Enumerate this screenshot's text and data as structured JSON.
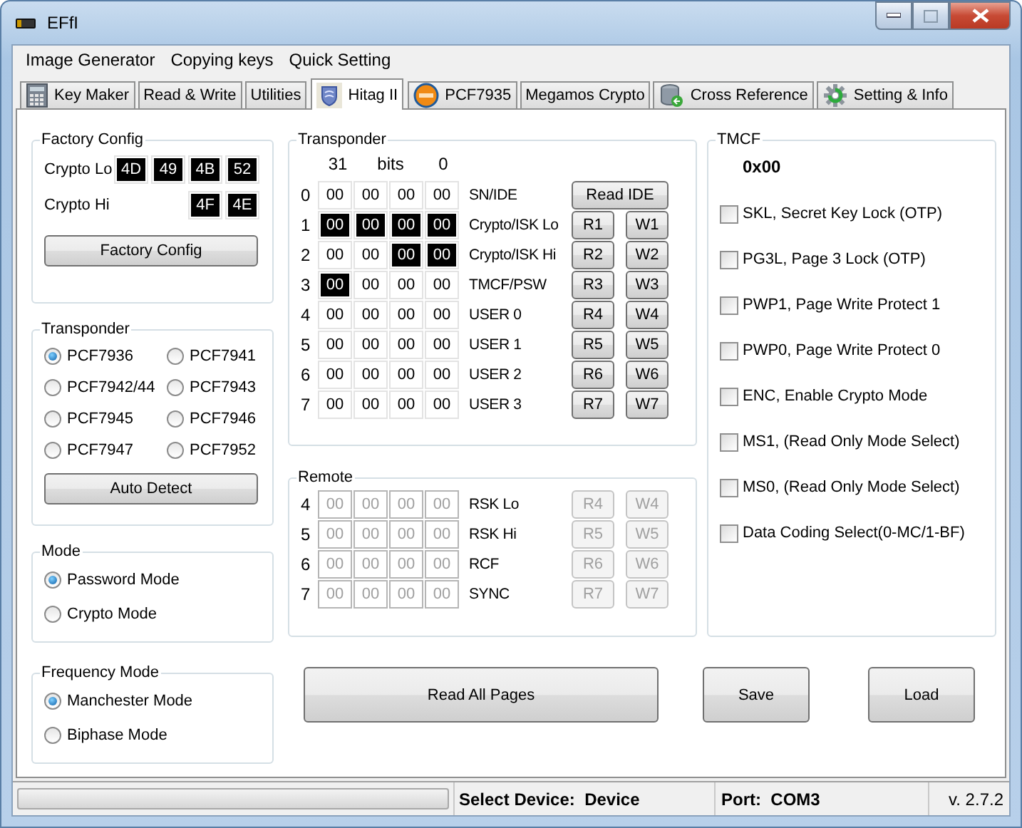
{
  "window": {
    "title": "EFfI"
  },
  "menu": [
    "Image Generator",
    "Copying keys",
    "Quick Setting"
  ],
  "tabs": [
    {
      "label": "Key Maker",
      "selected": false
    },
    {
      "label": "Read & Write",
      "selected": false
    },
    {
      "label": "Utilities",
      "selected": false
    },
    {
      "label": "Hitag II",
      "selected": true
    },
    {
      "label": "PCF7935",
      "selected": false
    },
    {
      "label": "Megamos Crypto",
      "selected": false
    },
    {
      "label": "Cross Reference",
      "selected": false
    },
    {
      "label": "Setting & Info",
      "selected": false
    }
  ],
  "factory_config": {
    "title": "Factory Config",
    "rows": [
      {
        "label": "Crypto Lo",
        "bytes": [
          "4D",
          "49",
          "4B",
          "52"
        ]
      },
      {
        "label": "Crypto Hi",
        "bytes": [
          "4F",
          "4E"
        ]
      }
    ],
    "button": "Factory Config"
  },
  "transponder_type": {
    "title": "Transponder",
    "options": [
      {
        "label": "PCF7936",
        "selected": true
      },
      {
        "label": "PCF7941",
        "selected": false
      },
      {
        "label": "PCF7942/44",
        "selected": false
      },
      {
        "label": "PCF7943",
        "selected": false
      },
      {
        "label": "PCF7945",
        "selected": false
      },
      {
        "label": "PCF7946",
        "selected": false
      },
      {
        "label": "PCF7947",
        "selected": false
      },
      {
        "label": "PCF7952",
        "selected": false
      }
    ],
    "button": "Auto Detect"
  },
  "mode": {
    "title": "Mode",
    "options": [
      {
        "label": "Password Mode",
        "selected": true
      },
      {
        "label": "Crypto Mode",
        "selected": false
      }
    ]
  },
  "frequency_mode": {
    "title": "Frequency Mode",
    "options": [
      {
        "label": "Manchester Mode",
        "selected": true
      },
      {
        "label": "Biphase Mode",
        "selected": false
      }
    ]
  },
  "transponder": {
    "title": "Transponder",
    "disabled": false,
    "header": {
      "msb": "31",
      "unit": "bits",
      "lsb": "0"
    },
    "pages": [
      {
        "index": "0",
        "bytes": [
          {
            "value": "00",
            "highlighted": false
          },
          {
            "value": "00",
            "highlighted": false
          },
          {
            "value": "00",
            "highlighted": false
          },
          {
            "value": "00",
            "highlighted": false
          }
        ],
        "name": "SN/IDE",
        "buttons": [
          "Read IDE"
        ]
      },
      {
        "index": "1",
        "bytes": [
          {
            "value": "00",
            "highlighted": true
          },
          {
            "value": "00",
            "highlighted": true
          },
          {
            "value": "00",
            "highlighted": true
          },
          {
            "value": "00",
            "highlighted": true
          }
        ],
        "name": "Crypto/ISK Lo",
        "buttons": [
          "R1",
          "W1"
        ]
      },
      {
        "index": "2",
        "bytes": [
          {
            "value": "00",
            "highlighted": false
          },
          {
            "value": "00",
            "highlighted": false
          },
          {
            "value": "00",
            "highlighted": true
          },
          {
            "value": "00",
            "highlighted": true
          }
        ],
        "name": "Crypto/ISK Hi",
        "buttons": [
          "R2",
          "W2"
        ]
      },
      {
        "index": "3",
        "bytes": [
          {
            "value": "00",
            "highlighted": true
          },
          {
            "value": "00",
            "highlighted": false
          },
          {
            "value": "00",
            "highlighted": false
          },
          {
            "value": "00",
            "highlighted": false
          }
        ],
        "name": "TMCF/PSW",
        "buttons": [
          "R3",
          "W3"
        ]
      },
      {
        "index": "4",
        "bytes": [
          {
            "value": "00",
            "highlighted": false
          },
          {
            "value": "00",
            "highlighted": false
          },
          {
            "value": "00",
            "highlighted": false
          },
          {
            "value": "00",
            "highlighted": false
          }
        ],
        "name": "USER 0",
        "buttons": [
          "R4",
          "W4"
        ]
      },
      {
        "index": "5",
        "bytes": [
          {
            "value": "00",
            "highlighted": false
          },
          {
            "value": "00",
            "highlighted": false
          },
          {
            "value": "00",
            "highlighted": false
          },
          {
            "value": "00",
            "highlighted": false
          }
        ],
        "name": "USER 1",
        "buttons": [
          "R5",
          "W5"
        ]
      },
      {
        "index": "6",
        "bytes": [
          {
            "value": "00",
            "highlighted": false
          },
          {
            "value": "00",
            "highlighted": false
          },
          {
            "value": "00",
            "highlighted": false
          },
          {
            "value": "00",
            "highlighted": false
          }
        ],
        "name": "USER 2",
        "buttons": [
          "R6",
          "W6"
        ]
      },
      {
        "index": "7",
        "bytes": [
          {
            "value": "00",
            "highlighted": false
          },
          {
            "value": "00",
            "highlighted": false
          },
          {
            "value": "00",
            "highlighted": false
          },
          {
            "value": "00",
            "highlighted": false
          }
        ],
        "name": "USER 3",
        "buttons": [
          "R7",
          "W7"
        ]
      }
    ]
  },
  "remote": {
    "title": "Remote",
    "disabled": true,
    "pages": [
      {
        "index": "4",
        "bytes": [
          {
            "value": "00",
            "highlighted": false
          },
          {
            "value": "00",
            "highlighted": false
          },
          {
            "value": "00",
            "highlighted": false
          },
          {
            "value": "00",
            "highlighted": false
          }
        ],
        "name": "RSK Lo",
        "buttons": [
          "R4",
          "W4"
        ]
      },
      {
        "index": "5",
        "bytes": [
          {
            "value": "00",
            "highlighted": false
          },
          {
            "value": "00",
            "highlighted": false
          },
          {
            "value": "00",
            "highlighted": false
          },
          {
            "value": "00",
            "highlighted": false
          }
        ],
        "name": "RSK Hi",
        "buttons": [
          "R5",
          "W5"
        ]
      },
      {
        "index": "6",
        "bytes": [
          {
            "value": "00",
            "highlighted": false
          },
          {
            "value": "00",
            "highlighted": false
          },
          {
            "value": "00",
            "highlighted": false
          },
          {
            "value": "00",
            "highlighted": false
          }
        ],
        "name": "RCF",
        "buttons": [
          "R6",
          "W6"
        ]
      },
      {
        "index": "7",
        "bytes": [
          {
            "value": "00",
            "highlighted": false
          },
          {
            "value": "00",
            "highlighted": false
          },
          {
            "value": "00",
            "highlighted": false
          },
          {
            "value": "00",
            "highlighted": false
          }
        ],
        "name": "SYNC",
        "buttons": [
          "R7",
          "W7"
        ]
      }
    ]
  },
  "tmcf": {
    "title": "TMCF",
    "value": "0x00",
    "flags": [
      {
        "label": "SKL, Secret Key Lock (OTP)",
        "checked": false
      },
      {
        "label": "PG3L, Page 3 Lock (OTP)",
        "checked": false
      },
      {
        "label": "PWP1, Page Write Protect 1",
        "checked": false
      },
      {
        "label": "PWP0, Page Write Protect 0",
        "checked": false
      },
      {
        "label": "ENC, Enable Crypto Mode",
        "checked": false
      },
      {
        "label": "MS1, (Read Only Mode Select)",
        "checked": false
      },
      {
        "label": "MS0, (Read Only Mode Select)",
        "checked": false
      },
      {
        "label": "Data Coding Select(0-MC/1-BF)",
        "checked": false
      }
    ]
  },
  "actions": [
    "Read All Pages",
    "Save",
    "Load"
  ],
  "status_bar": {
    "progress": {
      "level": 0
    },
    "device_label": "Select Device:",
    "device": "Device",
    "port_label": "Port:",
    "port": "COM3",
    "version": "v. 2.7.2"
  }
}
